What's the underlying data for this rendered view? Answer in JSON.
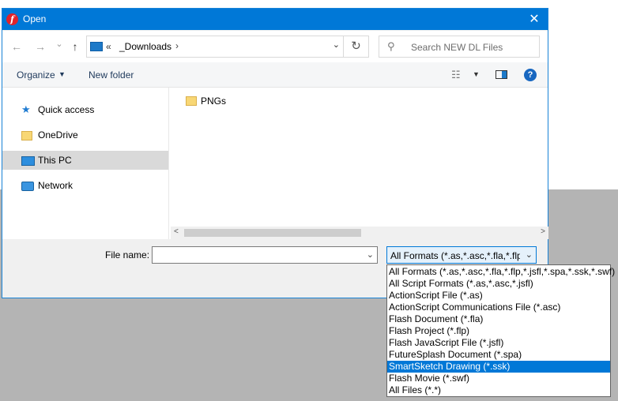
{
  "window": {
    "title": "Open",
    "app_icon": "flash-icon",
    "close_glyph": "✕"
  },
  "navbar": {
    "back_glyph": "←",
    "forward_glyph": "→",
    "recent_glyph": "⌄",
    "up_glyph": "↑",
    "address_chevrons": "«",
    "address_path": "_Downloads",
    "address_sep": "›",
    "address_dropdown": "⌄",
    "refresh_glyph": "↻",
    "search_placeholder": "Search NEW DL Files"
  },
  "toolbar": {
    "organize_label": "Organize",
    "organize_caret": "▼",
    "new_folder_label": "New folder",
    "view_glyph": "☷",
    "view_caret": "▼",
    "help_glyph": "?"
  },
  "sidebar": {
    "items": [
      {
        "label": "Quick access",
        "icon": "star-icon"
      },
      {
        "label": "OneDrive",
        "icon": "folder-icon"
      },
      {
        "label": "This PC",
        "icon": "computer-icon",
        "selected": true
      },
      {
        "label": "Network",
        "icon": "network-icon"
      }
    ]
  },
  "files": {
    "items": [
      {
        "label": "PNGs",
        "icon": "folder-icon"
      }
    ]
  },
  "scrollbar": {
    "left_glyph": "<",
    "right_glyph": ">"
  },
  "bottom": {
    "file_name_label": "File name:",
    "file_name_value": "",
    "file_name_dropdown": "⌄",
    "filter_selected": "All Formats (*.as,*.asc,*.fla,*.flp,",
    "filter_caret": "⌄"
  },
  "filter_options": [
    "All Formats (*.as,*.asc,*.fla,*.flp,*.jsfl,*.spa,*.ssk,*.swf)",
    "All Script Formats (*.as,*.asc,*.jsfl)",
    "ActionScript File (*.as)",
    "ActionScript Communications File (*.asc)",
    "Flash Document (*.fla)",
    "Flash Project (*.flp)",
    "Flash JavaScript File (*.jsfl)",
    "FutureSplash Document (*.spa)",
    "SmartSketch Drawing (*.ssk)",
    "Flash Movie (*.swf)",
    "All Files (*.*)"
  ],
  "filter_highlighted_index": 8,
  "colors": {
    "accent": "#0078d7",
    "selection": "#d9d9d9",
    "backdrop": "#b4b4b4"
  }
}
